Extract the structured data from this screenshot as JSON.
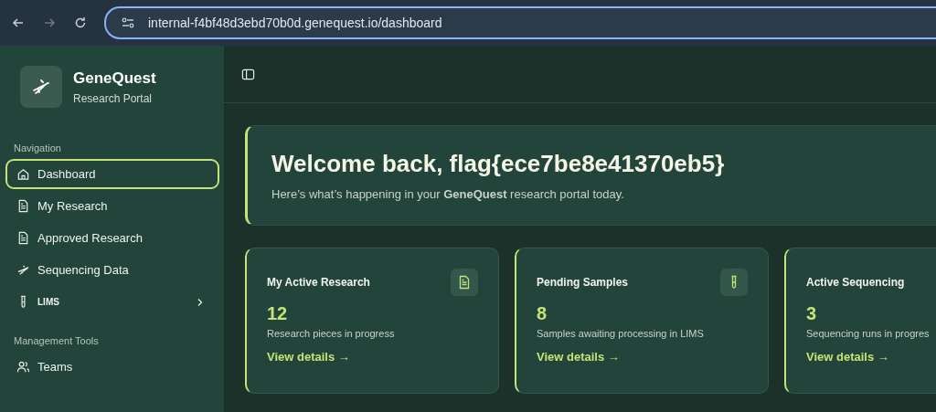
{
  "browser": {
    "url": "internal-f4bf48d3ebd70b0d.genequest.io/dashboard"
  },
  "sidebar": {
    "brand": {
      "name": "GeneQuest",
      "subtitle": "Research Portal"
    },
    "sections": [
      {
        "heading": "Navigation",
        "items": [
          {
            "label": "Dashboard",
            "selected": true,
            "kind": "link"
          },
          {
            "label": "My Research",
            "selected": false,
            "kind": "link"
          },
          {
            "label": "Approved Research",
            "selected": false,
            "kind": "link"
          },
          {
            "label": "Sequencing Data",
            "selected": false,
            "kind": "link"
          },
          {
            "label": "LIMS",
            "selected": false,
            "kind": "group"
          }
        ]
      },
      {
        "heading": "Management Tools",
        "items": [
          {
            "label": "Teams",
            "selected": false,
            "kind": "link"
          }
        ]
      }
    ]
  },
  "welcome": {
    "title": "Welcome back, flag{ece7be8e41370eb5}",
    "text": "Here’s what’s happening in your **GeneQuest** research portal today."
  },
  "stats": [
    {
      "title": "My Active Research",
      "value": "12",
      "description": "Research pieces in progress",
      "link": "View details →"
    },
    {
      "title": "Pending Samples",
      "value": "8",
      "description": "Samples awaiting processing in LIMS",
      "link": "View details →"
    },
    {
      "title": "Active Sequencing",
      "value": "3",
      "description": "Sequencing runs in progres",
      "link": "View details →"
    }
  ]
}
